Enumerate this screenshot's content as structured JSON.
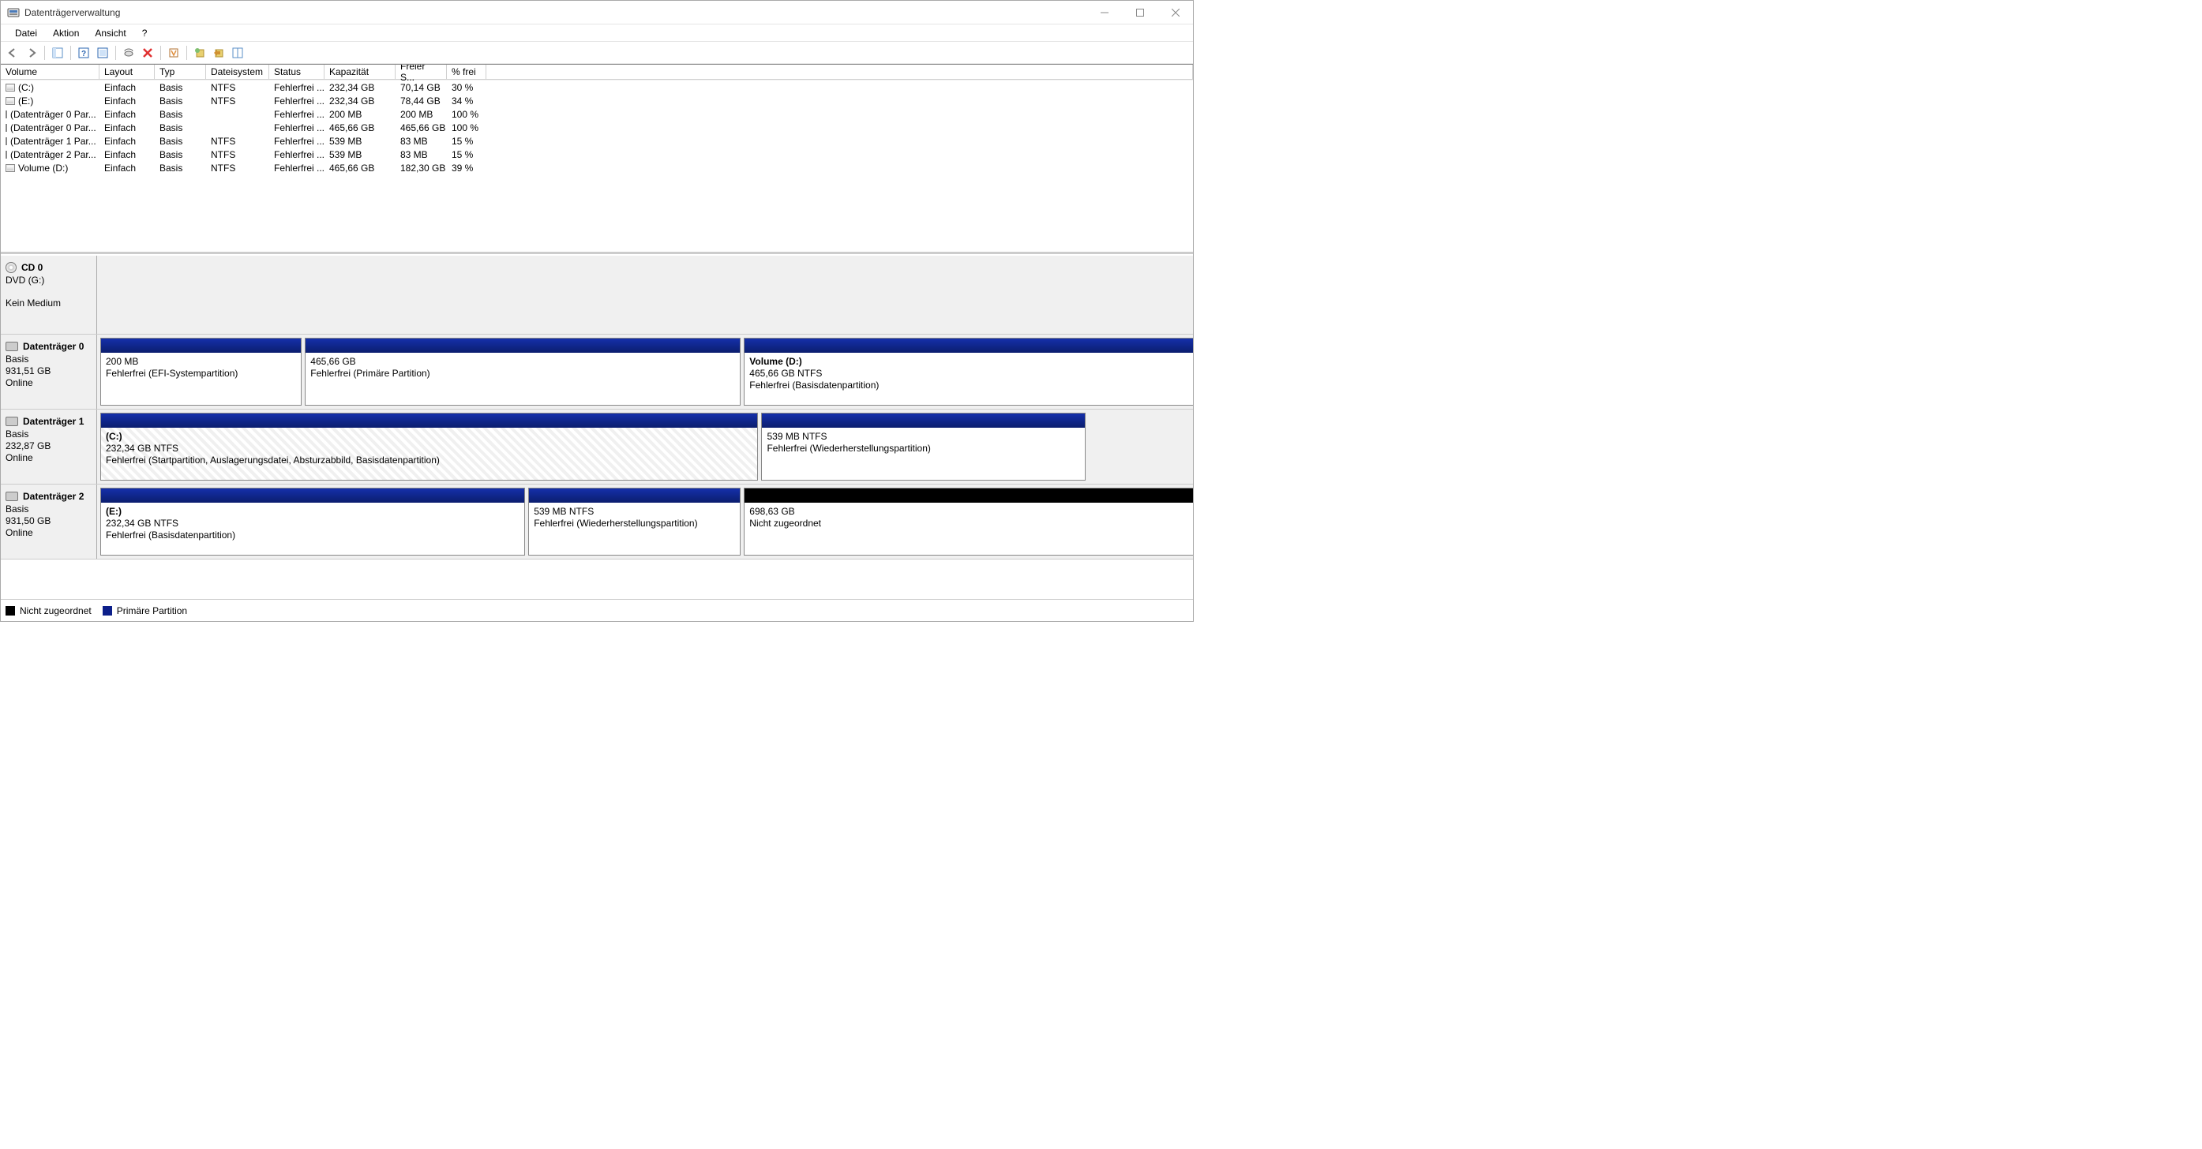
{
  "title": "Datenträgerverwaltung",
  "menubar": [
    "Datei",
    "Aktion",
    "Ansicht",
    "?"
  ],
  "columns": {
    "volume": "Volume",
    "layout": "Layout",
    "type": "Typ",
    "fs": "Dateisystem",
    "status": "Status",
    "cap": "Kapazität",
    "free": "Freier S...",
    "pct": "% frei"
  },
  "volumes": [
    {
      "name": "(C:)",
      "layout": "Einfach",
      "type": "Basis",
      "fs": "NTFS",
      "status": "Fehlerfrei ...",
      "cap": "232,34 GB",
      "free": "70,14 GB",
      "pct": "30 %"
    },
    {
      "name": "(E:)",
      "layout": "Einfach",
      "type": "Basis",
      "fs": "NTFS",
      "status": "Fehlerfrei ...",
      "cap": "232,34 GB",
      "free": "78,44 GB",
      "pct": "34 %"
    },
    {
      "name": "(Datenträger 0 Par...",
      "layout": "Einfach",
      "type": "Basis",
      "fs": "",
      "status": "Fehlerfrei ...",
      "cap": "200 MB",
      "free": "200 MB",
      "pct": "100 %"
    },
    {
      "name": "(Datenträger 0 Par...",
      "layout": "Einfach",
      "type": "Basis",
      "fs": "",
      "status": "Fehlerfrei ...",
      "cap": "465,66 GB",
      "free": "465,66 GB",
      "pct": "100 %"
    },
    {
      "name": "(Datenträger 1 Par...",
      "layout": "Einfach",
      "type": "Basis",
      "fs": "NTFS",
      "status": "Fehlerfrei ...",
      "cap": "539 MB",
      "free": "83 MB",
      "pct": "15 %"
    },
    {
      "name": "(Datenträger 2 Par...",
      "layout": "Einfach",
      "type": "Basis",
      "fs": "NTFS",
      "status": "Fehlerfrei ...",
      "cap": "539 MB",
      "free": "83 MB",
      "pct": "15 %"
    },
    {
      "name": "Volume (D:)",
      "layout": "Einfach",
      "type": "Basis",
      "fs": "NTFS",
      "status": "Fehlerfrei ...",
      "cap": "465,66 GB",
      "free": "182,30 GB",
      "pct": "39 %"
    }
  ],
  "disks": [
    {
      "name": "CD 0",
      "type": "DVD (G:)",
      "size": "",
      "status": "Kein Medium",
      "icon": "cd",
      "parts": []
    },
    {
      "name": "Datenträger 0",
      "type": "Basis",
      "size": "931,51 GB",
      "status": "Online",
      "icon": "hd",
      "parts": [
        {
          "header": "blue",
          "widthPct": 18.5,
          "title": "",
          "line1": "200 MB",
          "line2": "Fehlerfrei (EFI-Systempartition)"
        },
        {
          "header": "blue",
          "widthPct": 40,
          "title": "",
          "line1": "465,66 GB",
          "line2": "Fehlerfrei (Primäre Partition)"
        },
        {
          "header": "blue",
          "widthPct": 41.5,
          "title": "Volume  (D:)",
          "line1": "465,66 GB NTFS",
          "line2": "Fehlerfrei (Basisdatenpartition)"
        }
      ]
    },
    {
      "name": "Datenträger 1",
      "type": "Basis",
      "size": "232,87 GB",
      "status": "Online",
      "icon": "hd",
      "short": true,
      "parts": [
        {
          "header": "blue",
          "widthPct": 67,
          "selected": true,
          "title": " (C:)",
          "line1": "232,34 GB NTFS",
          "line2": "Fehlerfrei (Startpartition, Auslagerungsdatei, Absturzabbild, Basisdatenpartition)"
        },
        {
          "header": "blue",
          "widthPct": 33,
          "trailing": true,
          "title": "",
          "line1": "539 MB NTFS",
          "line2": "Fehlerfrei (Wiederherstellungspartition)"
        }
      ]
    },
    {
      "name": "Datenträger 2",
      "type": "Basis",
      "size": "931,50 GB",
      "status": "Online",
      "icon": "hd",
      "parts": [
        {
          "header": "blue",
          "widthPct": 39,
          "title": " (E:)",
          "line1": "232,34 GB NTFS",
          "line2": "Fehlerfrei (Basisdatenpartition)"
        },
        {
          "header": "blue",
          "widthPct": 19.5,
          "title": "",
          "line1": "539 MB NTFS",
          "line2": "Fehlerfrei (Wiederherstellungspartition)"
        },
        {
          "header": "black",
          "widthPct": 41.5,
          "title": "",
          "line1": "698,63 GB",
          "line2": "Nicht zugeordnet"
        }
      ]
    }
  ],
  "legend": {
    "black": "Nicht zugeordnet",
    "blue": "Primäre Partition"
  }
}
